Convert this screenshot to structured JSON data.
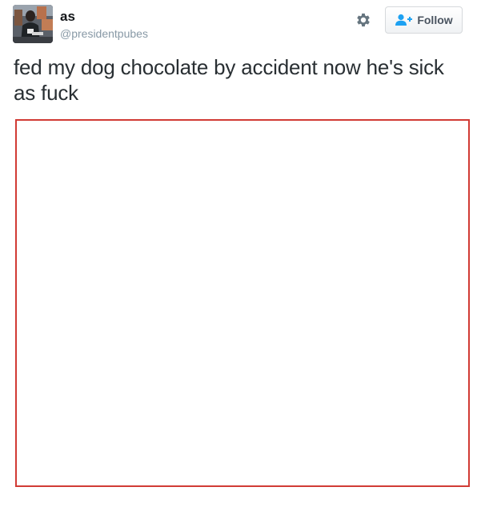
{
  "user": {
    "display_name": "as",
    "handle": "@presidentpubes"
  },
  "actions": {
    "settings_icon": "gear-icon",
    "follow_icon": "add-user-icon",
    "follow_label": "Follow"
  },
  "tweet": {
    "text": "fed my dog chocolate by accident now he's sick as fuck"
  },
  "colors": {
    "media_border": "#d13b35",
    "handle": "#8899a6",
    "follow_icon": "#1da1f2"
  }
}
